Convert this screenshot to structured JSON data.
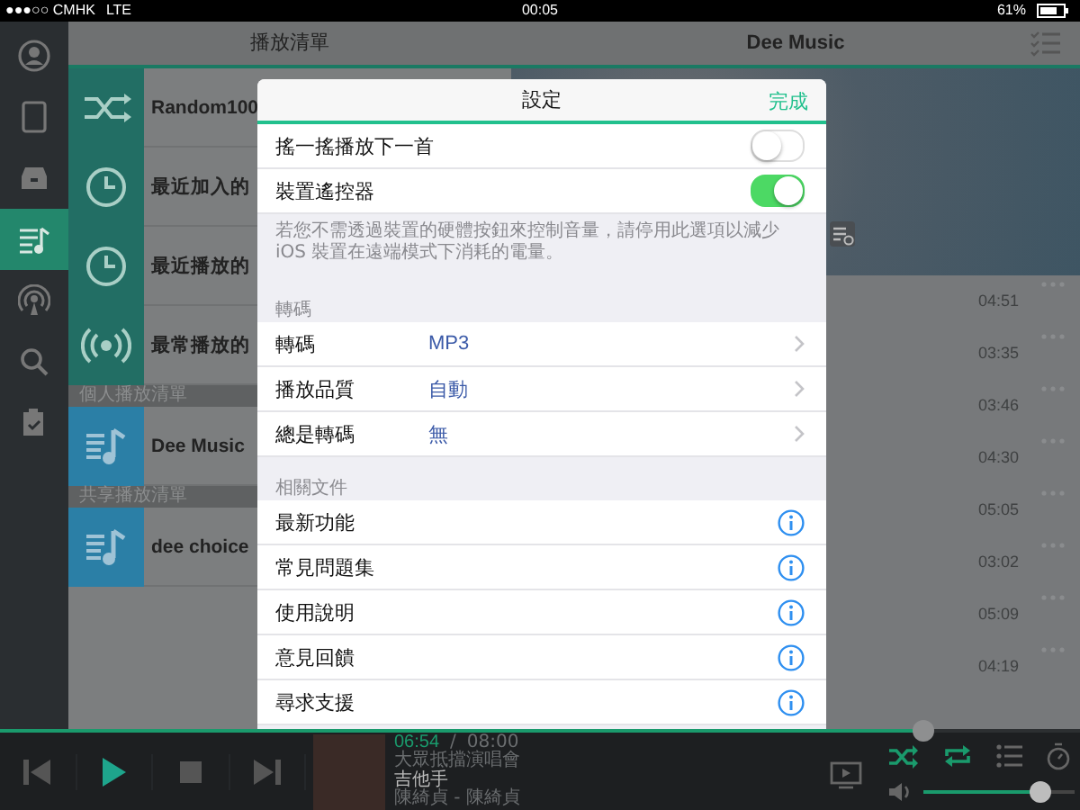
{
  "status_bar": {
    "carrier": "●●●○○ CMHK",
    "network": "LTE",
    "time": "00:05",
    "battery": "61%"
  },
  "nav_rail": [
    {
      "kind": "user",
      "selected": false
    },
    {
      "kind": "tablet",
      "selected": false
    },
    {
      "kind": "drawer",
      "selected": false
    },
    {
      "kind": "playlist",
      "selected": true
    },
    {
      "kind": "broadcast",
      "selected": false
    },
    {
      "kind": "search",
      "selected": false
    },
    {
      "kind": "clipboard",
      "selected": false
    }
  ],
  "playlists_panel": {
    "title": "播放清單",
    "sections": [
      {
        "items": [
          {
            "kind": "shuffle",
            "name": "Random100"
          },
          {
            "kind": "clock",
            "name": "最近加入的"
          },
          {
            "kind": "clock",
            "name": "最近播放的"
          },
          {
            "kind": "radio",
            "name": "最常播放的"
          }
        ]
      },
      {
        "header": "個人播放清單",
        "items": [
          {
            "kind": "note",
            "name": "Dee Music"
          }
        ]
      },
      {
        "header": "共享播放清單",
        "items": [
          {
            "kind": "note",
            "name": "dee choice"
          }
        ]
      }
    ]
  },
  "music_panel": {
    "title": "Dee Music",
    "tracks": [
      {
        "duration": "04:51"
      },
      {
        "duration": "03:35"
      },
      {
        "duration": "03:46"
      },
      {
        "duration": "04:30"
      },
      {
        "duration": "05:05"
      },
      {
        "duration": "03:02"
      },
      {
        "duration": "05:09"
      },
      {
        "duration": "04:19"
      }
    ]
  },
  "settings_dialog": {
    "title": "設定",
    "done": "完成",
    "toggles": [
      {
        "label": "搖一搖播放下一首",
        "on": false
      },
      {
        "label": "裝置遙控器",
        "on": true
      }
    ],
    "toggle_note": "若您不需透過裝置的硬體按鈕來控制音量，請停用此選項以減少 iOS 裝置在遠端模式下消耗的電量。",
    "transcode_section": {
      "header": "轉碼",
      "rows": [
        {
          "label": "轉碼",
          "value": "MP3"
        },
        {
          "label": "播放品質",
          "value": "自動"
        },
        {
          "label": "總是轉碼",
          "value": "無"
        }
      ]
    },
    "docs_section": {
      "header": "相關文件",
      "rows": [
        {
          "label": "最新功能"
        },
        {
          "label": "常見問題集"
        },
        {
          "label": "使用說明"
        },
        {
          "label": "意見回饋"
        },
        {
          "label": "尋求支援"
        }
      ]
    }
  },
  "player": {
    "progress": {
      "level": 0.855
    },
    "elapsed": "06:54",
    "separator": "/",
    "total": "08:00",
    "album": "大眾抵擋演唱會",
    "track": "吉他手",
    "artist": "陳綺貞 - 陳綺貞",
    "shuffle": true,
    "repeat": true,
    "volume": {
      "level": 0.77
    }
  }
}
